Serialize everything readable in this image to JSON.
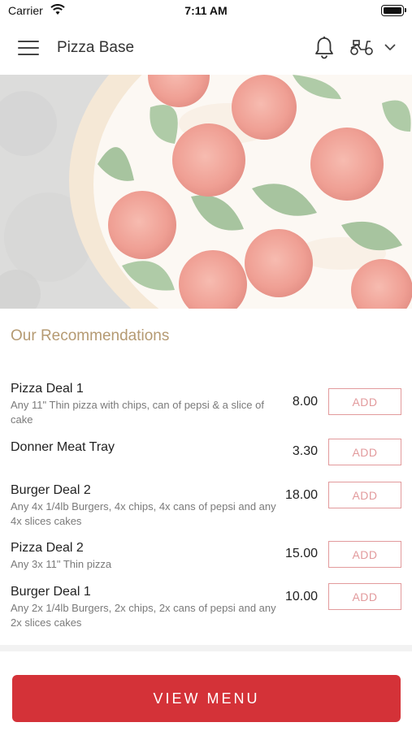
{
  "status_bar": {
    "carrier": "Carrier",
    "time": "7:11 AM"
  },
  "header": {
    "title": "Pizza Base",
    "icons": [
      "hamburger-menu-icon",
      "bell-icon",
      "delivery-scooter-icon",
      "chevron-down-icon"
    ]
  },
  "hero": {
    "image": "margherita-pizza-photo"
  },
  "recommendations": {
    "title": "Our Recommendations",
    "items": [
      {
        "name": "Pizza Deal 1",
        "description": "Any 11\" Thin pizza with chips, can of pepsi & a slice of cake",
        "price": "8.00",
        "button": "ADD"
      },
      {
        "name": "Donner Meat Tray",
        "description": "",
        "price": "3.30",
        "button": "ADD"
      },
      {
        "name": "Burger Deal 2",
        "description": "Any 4x 1/4lb Burgers, 4x chips, 4x cans of pepsi and any 4x slices cakes",
        "price": "18.00",
        "button": "ADD"
      },
      {
        "name": "Pizza Deal 2",
        "description": "Any 3x 11\" Thin pizza",
        "price": "15.00",
        "button": "ADD"
      },
      {
        "name": "Burger Deal 1",
        "description": "Any 2x 1/4lb Burgers, 2x chips, 2x cans of pepsi and any 2x slices cakes",
        "price": "10.00",
        "button": "ADD"
      }
    ]
  },
  "footer": {
    "view_menu_label": "VIEW MENU"
  },
  "colors": {
    "accent": "#d43238",
    "add_button": "#e29a9c",
    "section_title": "#b59a72"
  }
}
